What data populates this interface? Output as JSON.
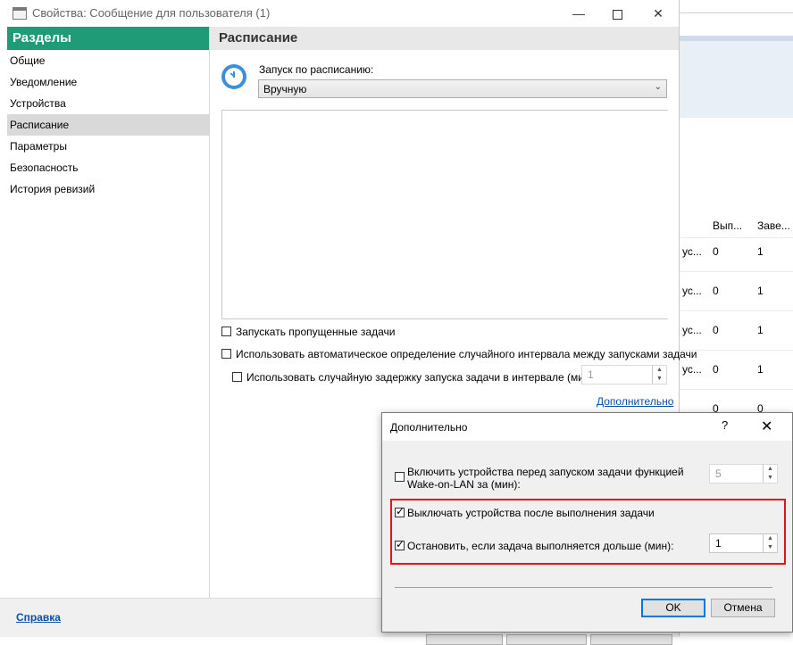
{
  "window": {
    "title": "Свойства: Сообщение для пользователя (1)",
    "min_label": "—",
    "close_label": "✕"
  },
  "sidebar": {
    "header": "Разделы",
    "items": [
      {
        "label": "Общие"
      },
      {
        "label": "Уведомление"
      },
      {
        "label": "Устройства"
      },
      {
        "label": "Расписание",
        "selected": true
      },
      {
        "label": "Параметры"
      },
      {
        "label": "Безопасность"
      },
      {
        "label": "История ревизий"
      }
    ]
  },
  "content": {
    "header": "Расписание",
    "schedule_label": "Запуск по расписанию:",
    "schedule_value": "Вручную",
    "run_missed_label": "Запускать пропущенные задачи",
    "auto_interval_label": "Использовать автоматическое определение случайного интервала между запусками задачи",
    "random_delay_label": "Использовать случайную задержку запуска задачи в интервале (мин):",
    "random_delay_value": "1",
    "more_link": "Дополнительно"
  },
  "footer": {
    "help_link": "Справка"
  },
  "background_table": {
    "headers": [
      "Вып...",
      "Заве..."
    ],
    "row_prefix": "ус...",
    "rows": [
      {
        "col1": "0",
        "col2": "1"
      },
      {
        "col1": "0",
        "col2": "1"
      },
      {
        "col1": "0",
        "col2": "1"
      },
      {
        "col1": "0",
        "col2": "1"
      },
      {
        "col1": "0",
        "col2": "0"
      }
    ]
  },
  "dialog": {
    "title": "Дополнительно",
    "help_label": "?",
    "close_label": "✕",
    "wol_label_line1": "Включить устройства перед запуском задачи функцией",
    "wol_label_line2": "Wake-on-LAN за (мин):",
    "wol_value": "5",
    "wol_checked": false,
    "shutdown_label": "Выключать устройства после выполнения задачи",
    "shutdown_checked": true,
    "stop_label": "Остановить, если задача выполняется дольше (мин):",
    "stop_checked": true,
    "stop_value": "1",
    "ok_label": "OK",
    "cancel_label": "Отмена",
    "highlight_color": "#e3141b"
  },
  "colors": {
    "sidebar_header": "#1f9b78",
    "link": "#0a4fa8"
  }
}
